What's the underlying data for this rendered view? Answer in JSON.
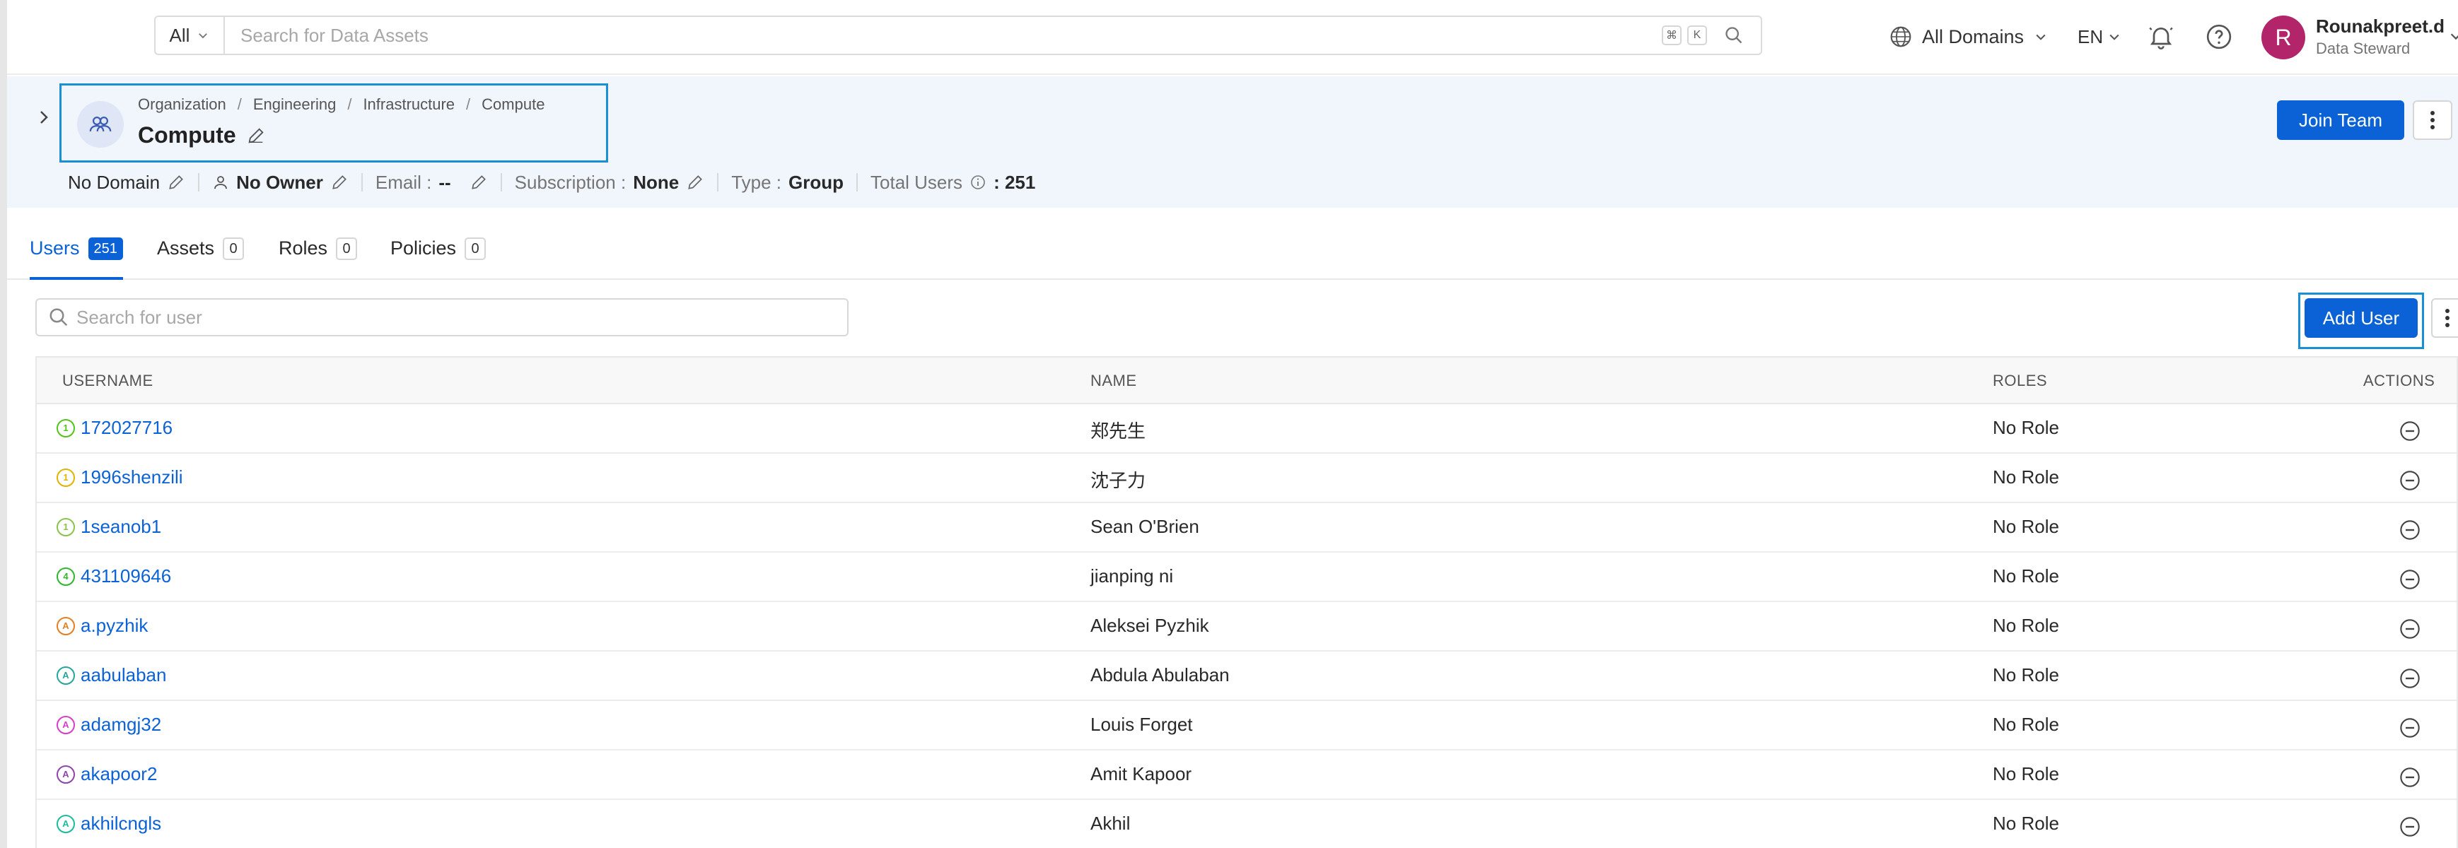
{
  "search": {
    "scope": "All",
    "placeholder": "Search for Data Assets",
    "shortcut_cmd": "⌘",
    "shortcut_key": "K"
  },
  "header": {
    "domains_label": "All Domains",
    "language": "EN",
    "user": {
      "initial": "R",
      "name": "Rounakpreet.d",
      "role": "Data Steward"
    }
  },
  "team": {
    "breadcrumb": [
      "Organization",
      "Engineering",
      "Infrastructure",
      "Compute"
    ],
    "name": "Compute",
    "join_label": "Join Team",
    "meta": {
      "domain": "No Domain",
      "owner": "No Owner",
      "email_label": "Email :",
      "email_value": "--",
      "subscription_label": "Subscription :",
      "subscription_value": "None",
      "type_label": "Type :",
      "type_value": "Group",
      "total_users_label": "Total Users",
      "total_users_value": ": 251"
    }
  },
  "tabs": [
    {
      "label": "Users",
      "count": "251"
    },
    {
      "label": "Assets",
      "count": "0"
    },
    {
      "label": "Roles",
      "count": "0"
    },
    {
      "label": "Policies",
      "count": "0"
    }
  ],
  "users_panel": {
    "search_placeholder": "Search for user",
    "add_label": "Add User"
  },
  "table": {
    "columns": [
      "USERNAME",
      "NAME",
      "ROLES",
      "ACTIONS"
    ],
    "rows": [
      {
        "initial": "1",
        "color": "#52c41a",
        "username": "172027716",
        "name": "郑先生",
        "role": "No Role"
      },
      {
        "initial": "1",
        "color": "#e0b400",
        "username": "1996shenzili",
        "name": "沈子力",
        "role": "No Role"
      },
      {
        "initial": "1",
        "color": "#8bc34a",
        "username": "1seanob1",
        "name": "Sean O'Brien",
        "role": "No Role"
      },
      {
        "initial": "4",
        "color": "#2eb82e",
        "username": "431109646",
        "name": "jianping ni",
        "role": "No Role"
      },
      {
        "initial": "A",
        "color": "#e67e22",
        "username": "a.pyzhik",
        "name": "Aleksei Pyzhik",
        "role": "No Role"
      },
      {
        "initial": "A",
        "color": "#26a69a",
        "username": "aabulaban",
        "name": "Abdula Abulaban",
        "role": "No Role"
      },
      {
        "initial": "A",
        "color": "#d63fc9",
        "username": "adamgj32",
        "name": "Louis Forget",
        "role": "No Role"
      },
      {
        "initial": "A",
        "color": "#8e44ad",
        "username": "akapoor2",
        "name": "Amit Kapoor",
        "role": "No Role"
      },
      {
        "initial": "A",
        "color": "#1abc9c",
        "username": "akhilcngls",
        "name": "Akhil",
        "role": "No Role"
      }
    ]
  }
}
